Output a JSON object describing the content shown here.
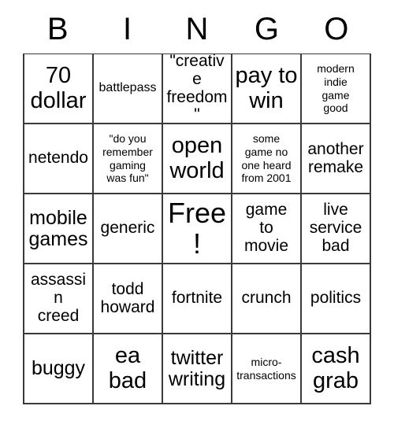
{
  "card": {
    "header_letters": [
      "B",
      "I",
      "N",
      "G",
      "O"
    ],
    "rows": [
      [
        {
          "text": "70\ndollar",
          "size": "xl"
        },
        {
          "text": "battlepass",
          "size": "sm"
        },
        {
          "text": "\"creative\nfreedom\"",
          "size": "md"
        },
        {
          "text": "pay to\nwin",
          "size": "xl"
        },
        {
          "text": "modern\nindie\ngame\ngood",
          "size": "xs"
        }
      ],
      [
        {
          "text": "netendo",
          "size": "md"
        },
        {
          "text": "\"do you\nremember\ngaming\nwas fun\"",
          "size": "xs"
        },
        {
          "text": "open\nworld",
          "size": "xl"
        },
        {
          "text": "some\ngame no\none heard\nfrom 2001",
          "size": "xs"
        },
        {
          "text": "another\nremake",
          "size": "md"
        }
      ],
      [
        {
          "text": "mobile\ngames",
          "size": "lg"
        },
        {
          "text": "generic",
          "size": "md"
        },
        {
          "text": "Free!",
          "size": "xxl"
        },
        {
          "text": "game\nto\nmovie",
          "size": "md"
        },
        {
          "text": "live\nservice\nbad",
          "size": "md"
        }
      ],
      [
        {
          "text": "assassin\ncreed",
          "size": "md"
        },
        {
          "text": "todd\nhoward",
          "size": "md"
        },
        {
          "text": "fortnite",
          "size": "md"
        },
        {
          "text": "crunch",
          "size": "md"
        },
        {
          "text": "politics",
          "size": "md"
        }
      ],
      [
        {
          "text": "buggy",
          "size": "lg"
        },
        {
          "text": "ea\nbad",
          "size": "xl"
        },
        {
          "text": "twitter\nwriting",
          "size": "lg"
        },
        {
          "text": "micro-\ntransactions",
          "size": "xs"
        },
        {
          "text": "cash\ngrab",
          "size": "xl"
        }
      ]
    ]
  },
  "colors": {
    "background": "#ffffff",
    "text": "#000000",
    "grid_line": "#3a3a3a"
  }
}
